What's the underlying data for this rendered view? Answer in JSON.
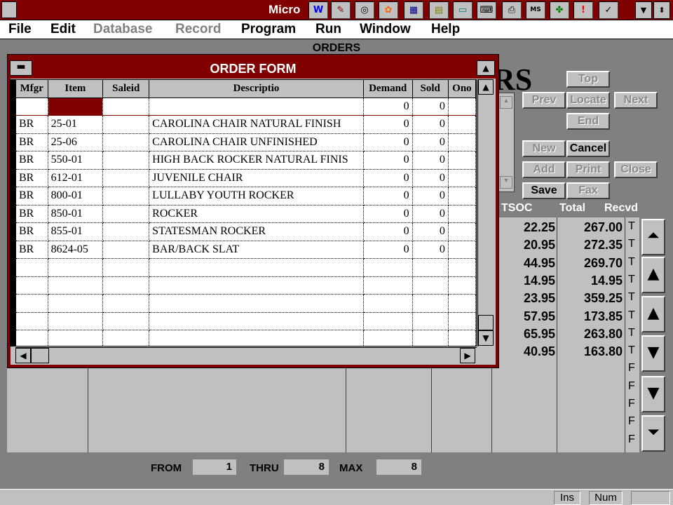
{
  "app": {
    "title": "Micro"
  },
  "toolbar": {
    "icons": [
      "word-icon",
      "tools-icon",
      "globe-icon",
      "butterfly-icon",
      "calculator-icon",
      "notebook-icon",
      "monitor-icon",
      "keyboard-icon",
      "printer-icon",
      "msdos-icon",
      "puzzle-icon",
      "alert-icon",
      "clipboard-icon"
    ]
  },
  "menu": {
    "file": "File",
    "edit": "Edit",
    "database": "Database",
    "record": "Record",
    "program": "Program",
    "run": "Run",
    "window": "Window",
    "help": "Help"
  },
  "orders_window": {
    "title": "ORDERS",
    "big_text": "RS",
    "buttons": {
      "top": "Top",
      "prev": "Prev",
      "locate": "Locate",
      "next": "Next",
      "end": "End",
      "new": "New",
      "cancel": "Cancel",
      "add": "Add",
      "print": "Print",
      "close": "Close",
      "save": "Save",
      "fax": "Fax"
    },
    "col_headers": {
      "tsoc": "TSOC",
      "total": "Total",
      "recvd": "Recvd"
    },
    "rows": [
      {
        "tsoc": "22.25",
        "total": "267.00",
        "recvd": "T"
      },
      {
        "tsoc": "20.95",
        "total": "272.35",
        "recvd": "T"
      },
      {
        "tsoc": "44.95",
        "total": "269.70",
        "recvd": "T"
      },
      {
        "tsoc": "14.95",
        "total": "14.95",
        "recvd": "T"
      },
      {
        "tsoc": "23.95",
        "total": "359.25",
        "recvd": "T"
      },
      {
        "tsoc": "57.95",
        "total": "173.85",
        "recvd": "T"
      },
      {
        "tsoc": "65.95",
        "total": "263.80",
        "recvd": "T"
      },
      {
        "tsoc": "40.95",
        "total": "163.80",
        "recvd": "T"
      },
      {
        "tsoc": "",
        "total": "",
        "recvd": "F"
      },
      {
        "tsoc": "",
        "total": "",
        "recvd": "F"
      },
      {
        "tsoc": "",
        "total": "",
        "recvd": "F"
      },
      {
        "tsoc": "",
        "total": "",
        "recvd": "F"
      },
      {
        "tsoc": "",
        "total": "",
        "recvd": "F"
      }
    ],
    "footer": {
      "from_label": "FROM",
      "from_value": "1",
      "thru_label": "THRU",
      "thru_value": "8",
      "max_label": "MAX",
      "max_value": "8"
    }
  },
  "order_form": {
    "title": "ORDER FORM",
    "columns": [
      "Mfgr",
      "Item",
      "Saleid",
      "Descriptio",
      "Demand",
      "Sold",
      "Ono"
    ],
    "rows": [
      {
        "mfgr": "",
        "item": "",
        "saleid": "",
        "desc": "",
        "demand": "0",
        "sold": "0"
      },
      {
        "mfgr": "BR",
        "item": "25-01",
        "saleid": "",
        "desc": "CAROLINA CHAIR NATURAL FINISH",
        "demand": "0",
        "sold": "0"
      },
      {
        "mfgr": "BR",
        "item": "25-06",
        "saleid": "",
        "desc": "CAROLINA CHAIR UNFINISHED",
        "demand": "0",
        "sold": "0"
      },
      {
        "mfgr": "BR",
        "item": "550-01",
        "saleid": "",
        "desc": "HIGH BACK ROCKER NATURAL FINIS",
        "demand": "0",
        "sold": "0"
      },
      {
        "mfgr": "BR",
        "item": "612-01",
        "saleid": "",
        "desc": "JUVENILE CHAIR",
        "demand": "0",
        "sold": "0"
      },
      {
        "mfgr": "BR",
        "item": "800-01",
        "saleid": "",
        "desc": "LULLABY YOUTH ROCKER",
        "demand": "0",
        "sold": "0"
      },
      {
        "mfgr": "BR",
        "item": "850-01",
        "saleid": "",
        "desc": "ROCKER",
        "demand": "0",
        "sold": "0"
      },
      {
        "mfgr": "BR",
        "item": "855-01",
        "saleid": "",
        "desc": "STATESMAN ROCKER",
        "demand": "0",
        "sold": "0"
      },
      {
        "mfgr": "BR",
        "item": "8624-05",
        "saleid": "",
        "desc": "BAR/BACK SLAT",
        "demand": "0",
        "sold": "0"
      }
    ],
    "empty_rows": 5
  },
  "status": {
    "ins": "Ins",
    "num": "Num"
  },
  "colors": {
    "title_bar": "#800000",
    "face": "#c0c0c0",
    "mdi": "#808080"
  }
}
